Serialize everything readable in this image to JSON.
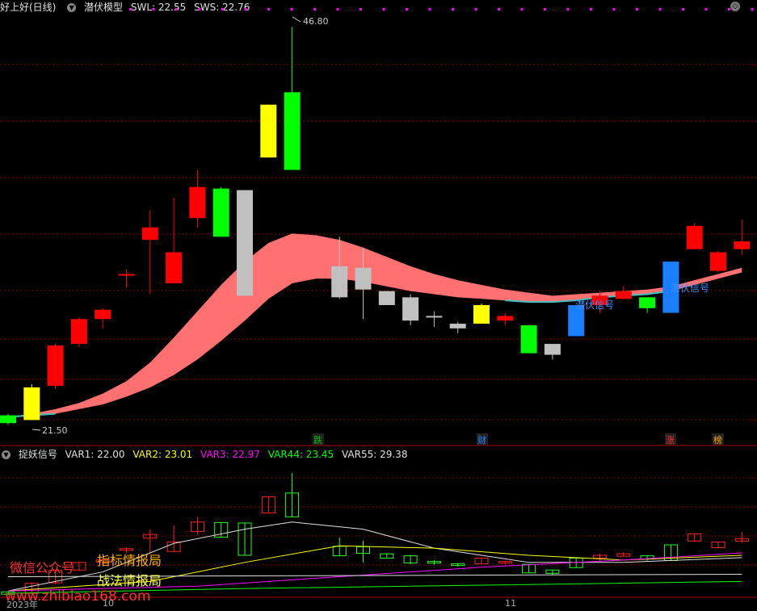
{
  "colors": {
    "up": "#ff0000",
    "down": "#00ff00",
    "yellow": "#ffff00",
    "gray": "#c0c0c0",
    "blue": "#1a7fff",
    "ribbon": "#ff7070",
    "ribbon_teal": "#40c0c0",
    "grid": "#8b0000",
    "magenta_dot": "#ff00ff"
  },
  "top_panel": {
    "title": "好上好(日线)",
    "indicator": "潜伏模型",
    "swl_label": "SWL: 22.55",
    "sws_label": "SWS: 22.76",
    "high_label": "46.80",
    "low_label": "21.50",
    "signal_labels": [
      "潜伏信号",
      "潜伏信号"
    ],
    "event_badges": [
      "跌",
      "财",
      "涨",
      "榜"
    ]
  },
  "bottom_panel": {
    "indicator": "捉妖信号",
    "var1": "VAR1: 22.00",
    "var2": "VAR2: 23.01",
    "var3": "VAR3: 22.97",
    "var44": "VAR44: 23.45",
    "var55": "VAR55: 29.38"
  },
  "axis": {
    "year_label": "2023年",
    "month_labels": [
      "10",
      "11"
    ]
  },
  "watermark": {
    "line1": "微信公众号",
    "line2": "指标情报局",
    "line3": "战法情报局",
    "url": "www.zhibiao168.com"
  },
  "chart_data": {
    "type": "candlestick",
    "candles": [
      {
        "o": 21.8,
        "c": 21.3,
        "h": 21.9,
        "l": 21.2,
        "color": "down"
      },
      {
        "o": 21.5,
        "c": 23.6,
        "h": 23.8,
        "l": 21.5,
        "color": "yellow"
      },
      {
        "o": 23.7,
        "c": 26.3,
        "h": 26.4,
        "l": 23.5,
        "color": "up"
      },
      {
        "o": 26.4,
        "c": 28.0,
        "h": 28.1,
        "l": 26.2,
        "color": "up"
      },
      {
        "o": 28.0,
        "c": 28.6,
        "h": 28.7,
        "l": 27.4,
        "color": "up"
      },
      {
        "o": 30.9,
        "c": 30.9,
        "h": 31.2,
        "l": 30.0,
        "color": "up"
      },
      {
        "o": 33.1,
        "c": 33.9,
        "h": 35.0,
        "l": 29.6,
        "color": "up"
      },
      {
        "o": 30.3,
        "c": 32.3,
        "h": 35.8,
        "l": 30.3,
        "color": "up"
      },
      {
        "o": 34.5,
        "c": 36.5,
        "h": 37.6,
        "l": 33.9,
        "color": "up"
      },
      {
        "o": 36.4,
        "c": 33.3,
        "h": 36.5,
        "l": 33.3,
        "color": "down"
      },
      {
        "o": 36.3,
        "c": 29.5,
        "h": 36.3,
        "l": 29.5,
        "color": "gray"
      },
      {
        "o": 38.4,
        "c": 41.8,
        "h": 41.8,
        "l": 38.4,
        "color": "yellow"
      },
      {
        "o": 42.6,
        "c": 37.6,
        "h": 46.8,
        "l": 37.6,
        "color": "down"
      },
      null,
      {
        "o": 31.4,
        "c": 29.4,
        "h": 33.3,
        "l": 29.3,
        "color": "gray"
      },
      {
        "o": 31.3,
        "c": 29.9,
        "h": 32.6,
        "l": 28.0,
        "color": "gray"
      },
      {
        "o": 29.8,
        "c": 28.9,
        "h": 29.8,
        "l": 28.9,
        "color": "gray"
      },
      {
        "o": 29.4,
        "c": 27.9,
        "h": 29.6,
        "l": 27.6,
        "color": "gray"
      },
      {
        "o": 28.2,
        "c": 28.1,
        "h": 28.5,
        "l": 27.5,
        "color": "gray"
      },
      {
        "o": 27.7,
        "c": 27.4,
        "h": 27.8,
        "l": 27.1,
        "color": "gray"
      },
      {
        "o": 27.7,
        "c": 28.9,
        "h": 29.0,
        "l": 27.7,
        "color": "yellow"
      },
      {
        "o": 28.2,
        "c": 27.9,
        "h": 28.4,
        "l": 27.6,
        "color": "up"
      },
      {
        "o": 27.6,
        "c": 25.8,
        "h": 27.6,
        "l": 25.8,
        "color": "down"
      },
      {
        "o": 26.4,
        "c": 25.7,
        "h": 26.4,
        "l": 25.4,
        "color": "gray"
      },
      {
        "o": 28.9,
        "c": 26.9,
        "h": 28.9,
        "l": 26.9,
        "color": "blue"
      },
      {
        "o": 28.9,
        "c": 29.5,
        "h": 29.8,
        "l": 28.4,
        "color": "up"
      },
      {
        "o": 29.3,
        "c": 29.8,
        "h": 30.1,
        "l": 29.3,
        "color": "up"
      },
      {
        "o": 28.7,
        "c": 29.4,
        "h": 29.4,
        "l": 28.4,
        "color": "down"
      },
      {
        "o": 31.7,
        "c": 28.4,
        "h": 31.7,
        "l": 28.4,
        "color": "blue"
      },
      {
        "o": 32.5,
        "c": 34.0,
        "h": 34.2,
        "l": 32.5,
        "color": "up"
      },
      {
        "o": 31.1,
        "c": 32.3,
        "h": 32.4,
        "l": 31.0,
        "color": "up"
      },
      {
        "o": 33.0,
        "c": 32.5,
        "h": 34.4,
        "l": 32.1,
        "color": "up"
      }
    ],
    "ribbon_upper": [
      21.7,
      21.9,
      22.2,
      22.6,
      23.2,
      24.0,
      25.2,
      26.8,
      28.5,
      30.2,
      31.7,
      32.9,
      33.5,
      33.4,
      33.1,
      32.6,
      32.0,
      31.4,
      30.9,
      30.5,
      30.2,
      29.9,
      29.7,
      29.5,
      29.6,
      29.7,
      29.8,
      29.9,
      30.1,
      30.5,
      30.9,
      31.3
    ],
    "ribbon_lower": [
      21.7,
      21.8,
      21.9,
      22.2,
      22.5,
      23.0,
      23.6,
      24.4,
      25.4,
      26.6,
      27.9,
      29.3,
      30.3,
      30.6,
      30.6,
      30.4,
      30.1,
      29.8,
      29.6,
      29.4,
      29.3,
      29.2,
      29.1,
      29.1,
      29.2,
      29.4,
      29.5,
      29.6,
      29.8,
      30.2,
      30.6,
      31.0
    ],
    "y_range": [
      21.0,
      47.5
    ]
  }
}
